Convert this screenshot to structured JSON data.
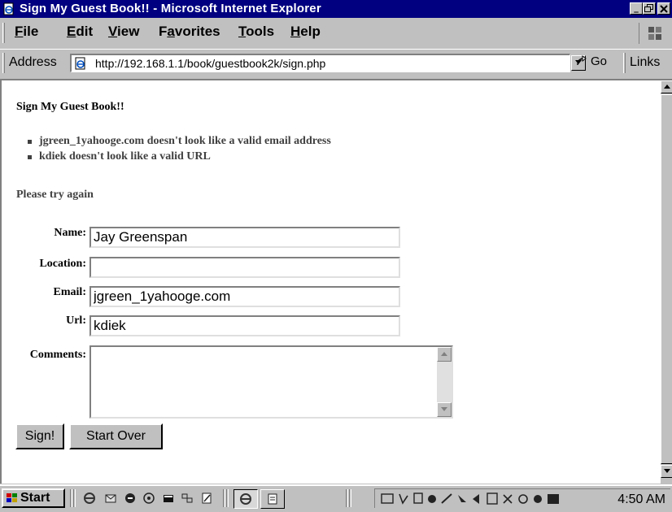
{
  "window": {
    "title": "Sign My Guest Book!! - Microsoft Internet Explorer",
    "controls": {
      "minimize": "_",
      "maximize": "ő",
      "close": "x"
    }
  },
  "menu": [
    {
      "label": "File",
      "accel": "F",
      "rest": "ile"
    },
    {
      "label": "Edit",
      "accel": "E",
      "rest": "dit"
    },
    {
      "label": "View",
      "accel": "V",
      "rest": "iew"
    },
    {
      "label": "Favorites",
      "lead": "F",
      "accel": "a",
      "rest": "vorites"
    },
    {
      "label": "Tools",
      "accel": "T",
      "rest": "ools"
    },
    {
      "label": "Help",
      "accel": "H",
      "rest": "elp"
    }
  ],
  "address_bar": {
    "label": "Address",
    "url": "http://192.168.1.1/book/guestbook2k/sign.php",
    "go_label": "Go",
    "links_label": "Links"
  },
  "page": {
    "title": "Sign My Guest Book!!",
    "errors": [
      "jgreen_1yahooge.com doesn't look like a valid email address",
      "kdiek doesn't look like a valid URL"
    ],
    "retry_message": "Please try again",
    "form": {
      "name_label": "Name:",
      "name_value": "Jay Greenspan",
      "location_label": "Location:",
      "location_value": "",
      "email_label": "Email:",
      "email_value": "jgreen_1yahooge.com",
      "url_label": "Url:",
      "url_value": "kdiek",
      "comments_label": "Comments:",
      "comments_value": "",
      "submit_label": "Sign!",
      "reset_label": "Start Over"
    }
  },
  "taskbar": {
    "start_label": "Start",
    "clock": "4:50 AM"
  },
  "colors": {
    "title_bar": "#000080",
    "chrome": "#c0c0c0",
    "error_text": "#404040"
  },
  "icons": {
    "app": "ie-page-icon",
    "go": "go-arrow-icon",
    "brand": "windows-logo-icon"
  }
}
